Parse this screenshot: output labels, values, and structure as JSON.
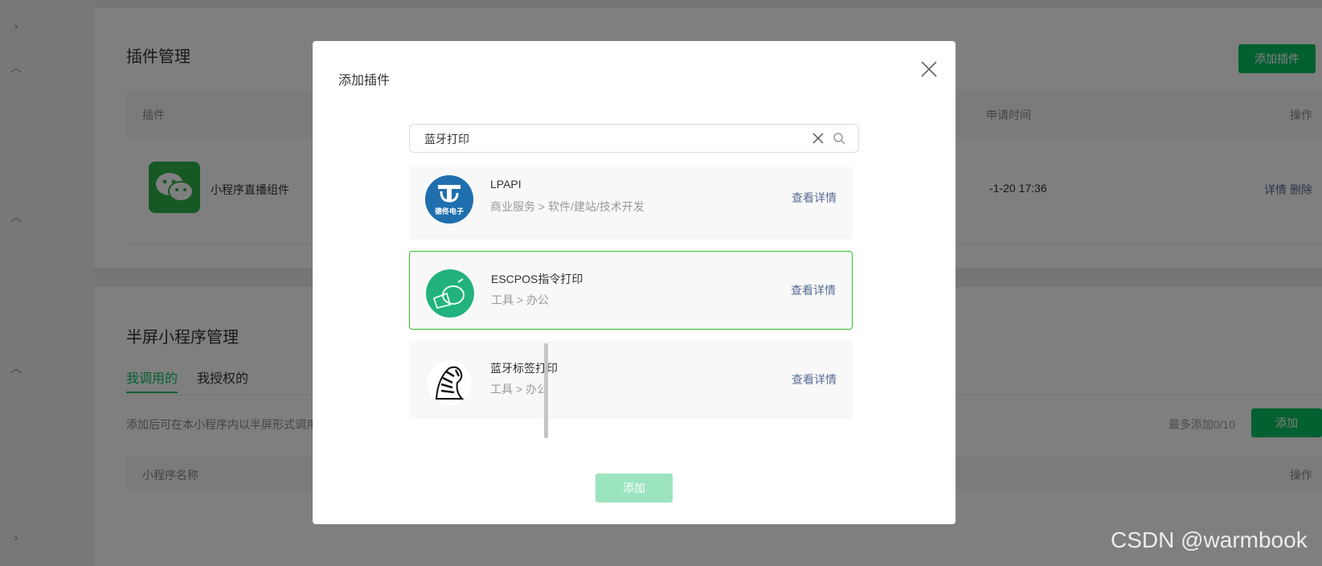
{
  "background": {
    "plugin_section": {
      "title": "插件管理",
      "add_button": "添加插件",
      "headers": {
        "plugin": "插件",
        "apply_time": "申请时间",
        "action": "操作"
      },
      "row": {
        "name": "小程序直播组件",
        "time": "-1-20 17:36",
        "detail": "详情",
        "delete": "删除"
      }
    },
    "half_screen_section": {
      "title": "半屏小程序管理",
      "tabs": [
        "我调用的",
        "我授权的"
      ],
      "description": "添加后可在本小程序内以半屏形式调用",
      "limit_text": "最多添加0/10",
      "add_button": "添加",
      "headers": {
        "name": "小程序名称",
        "action": "操作"
      }
    }
  },
  "modal": {
    "title": "添加插件",
    "search": {
      "value": "蓝牙打印",
      "placeholder": ""
    },
    "results": [
      {
        "name": "LPAPI",
        "category": "商业服务 > 软件/建站/技术开发",
        "detail": "查看详情",
        "logo_text": "德佟电子",
        "selected": false
      },
      {
        "name": "ESCPOS指令打印",
        "category": "工具 > 办公",
        "detail": "查看详情",
        "selected": true
      },
      {
        "name": "蓝牙标签打印",
        "category": "工具 > 办公",
        "detail": "查看详情",
        "selected": false
      }
    ],
    "add_button": "添加"
  },
  "watermark": "CSDN @warmbook",
  "colors": {
    "brand_green": "#07c160",
    "selected_border": "#35c22a",
    "link": "#576b95",
    "disabled_green": "#9be4be"
  }
}
